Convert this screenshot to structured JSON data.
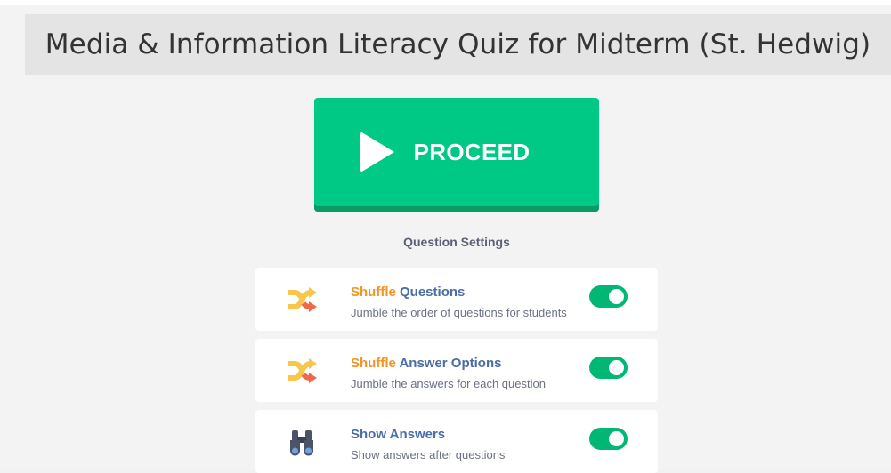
{
  "quiz": {
    "title": "Media & Information Literacy Quiz for Midterm (St. Hedwig)"
  },
  "proceed_button": {
    "label": "PROCEED",
    "icon": "play-icon"
  },
  "settings": {
    "heading": "Question Settings",
    "items": [
      {
        "title_accent": "Shuffle",
        "title_rest": " Questions",
        "description": "Jumble the order of questions for students",
        "icon": "shuffle-icon",
        "enabled": true
      },
      {
        "title_accent": "Shuffle",
        "title_rest": " Answer Options",
        "description": "Jumble the answers for each question",
        "icon": "shuffle-icon",
        "enabled": true
      },
      {
        "title_accent": "",
        "title_rest": "Show Answers",
        "description": "Show answers after questions",
        "icon": "binoculars-icon",
        "enabled": true
      }
    ]
  },
  "colors": {
    "primary_green": "#00c985",
    "toggle_green": "#00b873",
    "accent_orange": "#f29423",
    "title_blue": "#4a6ca8"
  }
}
